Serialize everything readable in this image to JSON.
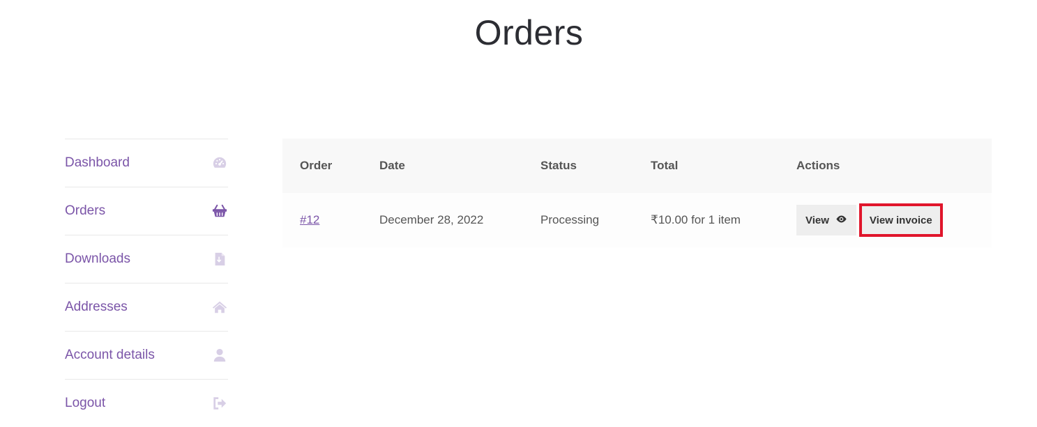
{
  "page": {
    "title": "Orders"
  },
  "nav": {
    "items": [
      {
        "label": "Dashboard",
        "icon": "dashboard-icon",
        "active": false
      },
      {
        "label": "Orders",
        "icon": "basket-icon",
        "active": true
      },
      {
        "label": "Downloads",
        "icon": "file-download-icon",
        "active": false
      },
      {
        "label": "Addresses",
        "icon": "home-icon",
        "active": false
      },
      {
        "label": "Account details",
        "icon": "user-icon",
        "active": false
      },
      {
        "label": "Logout",
        "icon": "logout-icon",
        "active": false
      }
    ]
  },
  "table": {
    "headers": {
      "order": "Order",
      "date": "Date",
      "status": "Status",
      "total": "Total",
      "actions": "Actions"
    },
    "rows": [
      {
        "order": "#12",
        "date": "December 28, 2022",
        "status": "Processing",
        "total": "₹10.00 for 1 item",
        "view_label": "View",
        "invoice_label": "View invoice"
      }
    ]
  },
  "colors": {
    "accent": "#7b55a8",
    "icon_muted": "#d8cfe6",
    "highlight": "#e0152b"
  }
}
